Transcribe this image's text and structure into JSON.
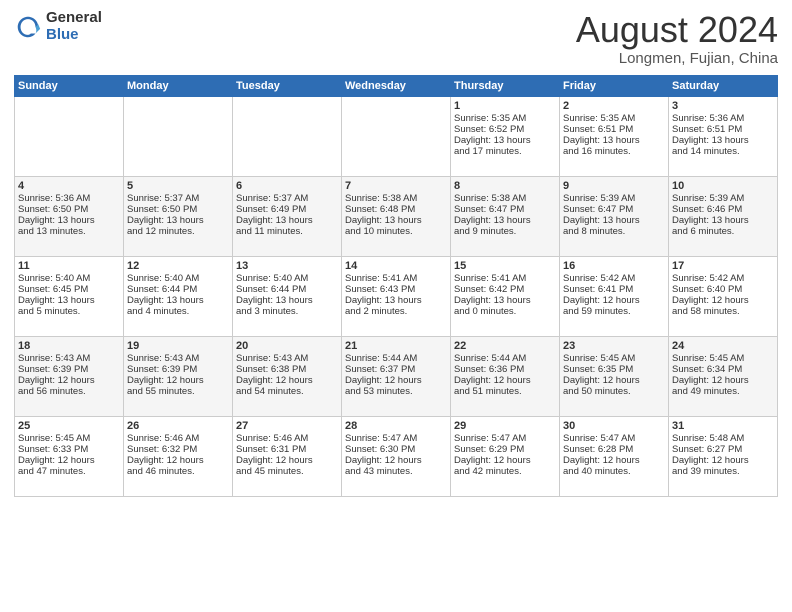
{
  "header": {
    "logo_general": "General",
    "logo_blue": "Blue",
    "month_title": "August 2024",
    "location": "Longmen, Fujian, China"
  },
  "days_of_week": [
    "Sunday",
    "Monday",
    "Tuesday",
    "Wednesday",
    "Thursday",
    "Friday",
    "Saturday"
  ],
  "weeks": [
    [
      {
        "day": "",
        "content": ""
      },
      {
        "day": "",
        "content": ""
      },
      {
        "day": "",
        "content": ""
      },
      {
        "day": "",
        "content": ""
      },
      {
        "day": "1",
        "content": "Sunrise: 5:35 AM\nSunset: 6:52 PM\nDaylight: 13 hours\nand 17 minutes."
      },
      {
        "day": "2",
        "content": "Sunrise: 5:35 AM\nSunset: 6:51 PM\nDaylight: 13 hours\nand 16 minutes."
      },
      {
        "day": "3",
        "content": "Sunrise: 5:36 AM\nSunset: 6:51 PM\nDaylight: 13 hours\nand 14 minutes."
      }
    ],
    [
      {
        "day": "4",
        "content": "Sunrise: 5:36 AM\nSunset: 6:50 PM\nDaylight: 13 hours\nand 13 minutes."
      },
      {
        "day": "5",
        "content": "Sunrise: 5:37 AM\nSunset: 6:50 PM\nDaylight: 13 hours\nand 12 minutes."
      },
      {
        "day": "6",
        "content": "Sunrise: 5:37 AM\nSunset: 6:49 PM\nDaylight: 13 hours\nand 11 minutes."
      },
      {
        "day": "7",
        "content": "Sunrise: 5:38 AM\nSunset: 6:48 PM\nDaylight: 13 hours\nand 10 minutes."
      },
      {
        "day": "8",
        "content": "Sunrise: 5:38 AM\nSunset: 6:47 PM\nDaylight: 13 hours\nand 9 minutes."
      },
      {
        "day": "9",
        "content": "Sunrise: 5:39 AM\nSunset: 6:47 PM\nDaylight: 13 hours\nand 8 minutes."
      },
      {
        "day": "10",
        "content": "Sunrise: 5:39 AM\nSunset: 6:46 PM\nDaylight: 13 hours\nand 6 minutes."
      }
    ],
    [
      {
        "day": "11",
        "content": "Sunrise: 5:40 AM\nSunset: 6:45 PM\nDaylight: 13 hours\nand 5 minutes."
      },
      {
        "day": "12",
        "content": "Sunrise: 5:40 AM\nSunset: 6:44 PM\nDaylight: 13 hours\nand 4 minutes."
      },
      {
        "day": "13",
        "content": "Sunrise: 5:40 AM\nSunset: 6:44 PM\nDaylight: 13 hours\nand 3 minutes."
      },
      {
        "day": "14",
        "content": "Sunrise: 5:41 AM\nSunset: 6:43 PM\nDaylight: 13 hours\nand 2 minutes."
      },
      {
        "day": "15",
        "content": "Sunrise: 5:41 AM\nSunset: 6:42 PM\nDaylight: 13 hours\nand 0 minutes."
      },
      {
        "day": "16",
        "content": "Sunrise: 5:42 AM\nSunset: 6:41 PM\nDaylight: 12 hours\nand 59 minutes."
      },
      {
        "day": "17",
        "content": "Sunrise: 5:42 AM\nSunset: 6:40 PM\nDaylight: 12 hours\nand 58 minutes."
      }
    ],
    [
      {
        "day": "18",
        "content": "Sunrise: 5:43 AM\nSunset: 6:39 PM\nDaylight: 12 hours\nand 56 minutes."
      },
      {
        "day": "19",
        "content": "Sunrise: 5:43 AM\nSunset: 6:39 PM\nDaylight: 12 hours\nand 55 minutes."
      },
      {
        "day": "20",
        "content": "Sunrise: 5:43 AM\nSunset: 6:38 PM\nDaylight: 12 hours\nand 54 minutes."
      },
      {
        "day": "21",
        "content": "Sunrise: 5:44 AM\nSunset: 6:37 PM\nDaylight: 12 hours\nand 53 minutes."
      },
      {
        "day": "22",
        "content": "Sunrise: 5:44 AM\nSunset: 6:36 PM\nDaylight: 12 hours\nand 51 minutes."
      },
      {
        "day": "23",
        "content": "Sunrise: 5:45 AM\nSunset: 6:35 PM\nDaylight: 12 hours\nand 50 minutes."
      },
      {
        "day": "24",
        "content": "Sunrise: 5:45 AM\nSunset: 6:34 PM\nDaylight: 12 hours\nand 49 minutes."
      }
    ],
    [
      {
        "day": "25",
        "content": "Sunrise: 5:45 AM\nSunset: 6:33 PM\nDaylight: 12 hours\nand 47 minutes."
      },
      {
        "day": "26",
        "content": "Sunrise: 5:46 AM\nSunset: 6:32 PM\nDaylight: 12 hours\nand 46 minutes."
      },
      {
        "day": "27",
        "content": "Sunrise: 5:46 AM\nSunset: 6:31 PM\nDaylight: 12 hours\nand 45 minutes."
      },
      {
        "day": "28",
        "content": "Sunrise: 5:47 AM\nSunset: 6:30 PM\nDaylight: 12 hours\nand 43 minutes."
      },
      {
        "day": "29",
        "content": "Sunrise: 5:47 AM\nSunset: 6:29 PM\nDaylight: 12 hours\nand 42 minutes."
      },
      {
        "day": "30",
        "content": "Sunrise: 5:47 AM\nSunset: 6:28 PM\nDaylight: 12 hours\nand 40 minutes."
      },
      {
        "day": "31",
        "content": "Sunrise: 5:48 AM\nSunset: 6:27 PM\nDaylight: 12 hours\nand 39 minutes."
      }
    ]
  ]
}
